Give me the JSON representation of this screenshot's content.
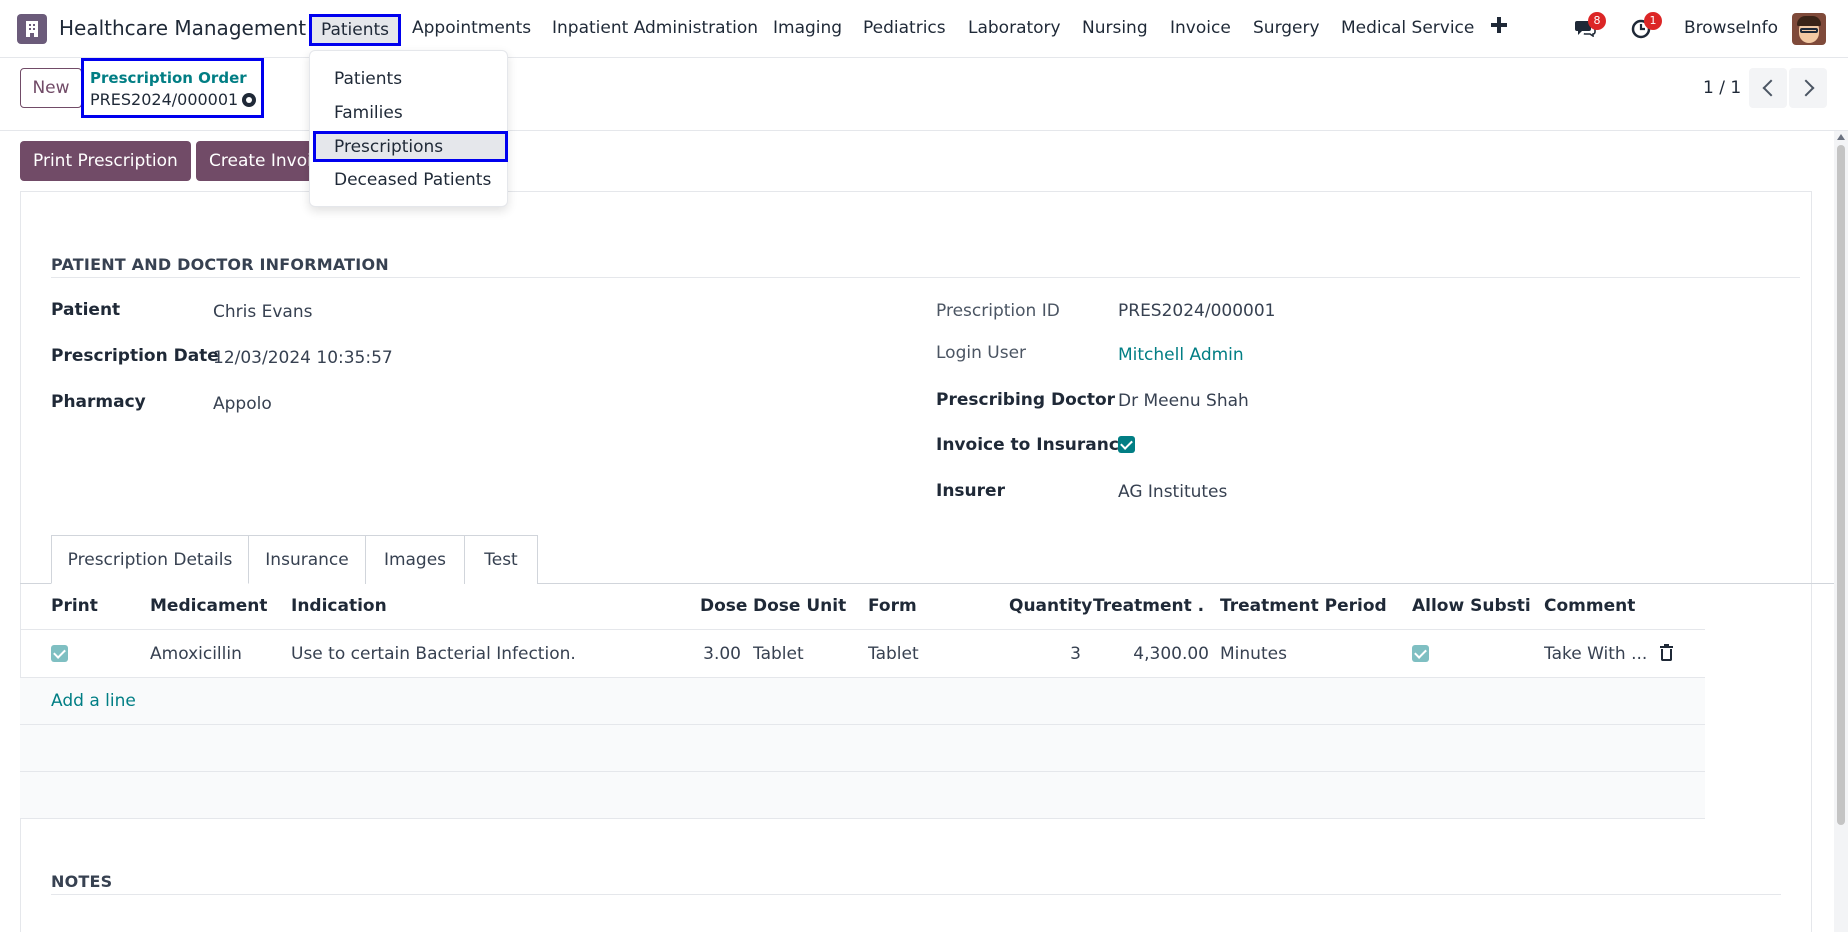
{
  "navbar": {
    "app_title": "Healthcare Management",
    "menus": [
      "Patients",
      "Appointments",
      "Inpatient Administration",
      "Imaging",
      "Pediatrics",
      "Laboratory",
      "Nursing",
      "Invoice",
      "Surgery",
      "Medical Service"
    ],
    "messages_count": "8",
    "activities_count": "1",
    "user_name": "BrowseInfo"
  },
  "dropdown": {
    "items": [
      "Patients",
      "Families",
      "Prescriptions",
      "Deceased Patients"
    ]
  },
  "control_panel": {
    "new_label": "New",
    "breadcrumb_title": "Prescription Order",
    "record_name": "PRES2024/000001",
    "pager": "1 / 1"
  },
  "actions": {
    "print_prescription": "Print Prescription",
    "create_invoice": "Create Invoice"
  },
  "form": {
    "section_title": "PATIENT AND DOCTOR INFORMATION",
    "left": {
      "patient_label": "Patient",
      "patient_value": "Chris Evans",
      "date_label": "Prescription Date",
      "date_value": "12/03/2024 10:35:57",
      "pharmacy_label": "Pharmacy",
      "pharmacy_value": "Appolo"
    },
    "right": {
      "id_label": "Prescription ID",
      "id_value": "PRES2024/000001",
      "login_label": "Login User",
      "login_value": "Mitchell Admin",
      "doctor_label": "Prescribing Doctor",
      "doctor_value": "Dr Meenu Shah",
      "invoice_ins_label": "Invoice to Insurance",
      "invoice_ins_checked": true,
      "insurer_label": "Insurer",
      "insurer_value": "AG Institutes"
    },
    "tabs": [
      "Prescription Details",
      "Insurance",
      "Images",
      "Test"
    ],
    "notes_title": "NOTES"
  },
  "table": {
    "headers": [
      "Print",
      "Medicament",
      "Indication",
      "Dose",
      "Dose Unit",
      "Form",
      "Quantity",
      "Treatment ...",
      "Treatment Period",
      "Allow Substi...",
      "Comment"
    ],
    "rows": [
      {
        "print": true,
        "medicament": "Amoxicillin",
        "indication": "Use to certain Bacterial Infection.",
        "dose": "3.00",
        "dose_unit": "Tablet",
        "form": "Tablet",
        "quantity": "3",
        "treatment": "4,300.00",
        "treatment_period": "Minutes",
        "allow_substitution": true,
        "comment": "Take With ..."
      }
    ],
    "add_line": "Add a line"
  }
}
